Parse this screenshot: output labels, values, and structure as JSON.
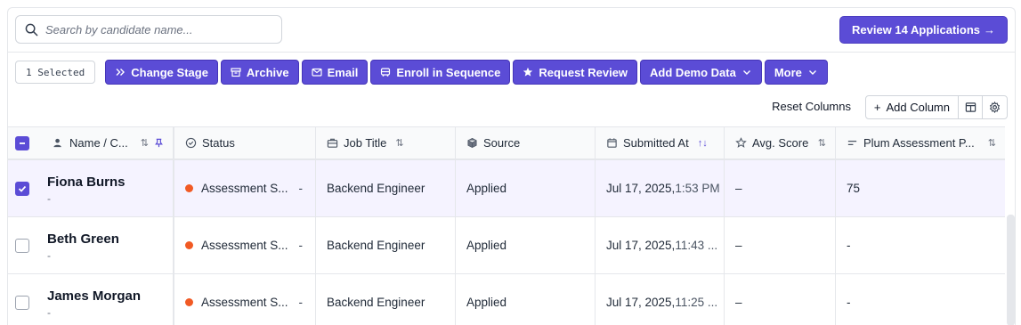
{
  "search": {
    "placeholder": "Search by candidate name..."
  },
  "review_button": {
    "label": "Review 14 Applications",
    "arrow": "→"
  },
  "toolbar": {
    "selected": "1 Selected",
    "buttons": [
      {
        "label": "Change Stage",
        "icon": "double-chevron-icon"
      },
      {
        "label": "Archive",
        "icon": "archive-icon"
      },
      {
        "label": "Email",
        "icon": "envelope-icon"
      },
      {
        "label": "Enroll in Sequence",
        "icon": "bus-icon"
      },
      {
        "label": "Request Review",
        "icon": "star-icon"
      },
      {
        "label": "Add Demo Data",
        "icon": "chevron-down-icon"
      },
      {
        "label": "More",
        "icon": "chevron-down-icon"
      }
    ]
  },
  "columns_controls": {
    "reset": "Reset Columns",
    "add": "Add Column"
  },
  "table": {
    "headers": [
      "Name / C...",
      "Status",
      "Job Title",
      "Source",
      "Submitted At",
      "Avg. Score",
      "Plum Assessment P..."
    ],
    "rows": [
      {
        "name": "Fiona Burns",
        "sub": "-",
        "status": "Assessment S...",
        "status_dash": "-",
        "job": "Backend Engineer",
        "source": "Applied",
        "date": "Jul 17, 2025,",
        "time": "1:53 PM",
        "score": "–",
        "plum": "75",
        "selected": true
      },
      {
        "name": "Beth Green",
        "sub": "-",
        "status": "Assessment S...",
        "status_dash": "-",
        "job": "Backend Engineer",
        "source": "Applied",
        "date": "Jul 17, 2025,",
        "time": "11:43 ...",
        "score": "–",
        "plum": "-",
        "selected": false
      },
      {
        "name": "James Morgan",
        "sub": "-",
        "status": "Assessment S...",
        "status_dash": "-",
        "job": "Backend Engineer",
        "source": "Applied",
        "date": "Jul 17, 2025,",
        "time": "11:25 ...",
        "score": "–",
        "plum": "-",
        "selected": false
      }
    ]
  },
  "colors": {
    "accent": "#5b4cd6",
    "status_dot": "#f15a24",
    "selected_row": "#f5f3ff"
  }
}
